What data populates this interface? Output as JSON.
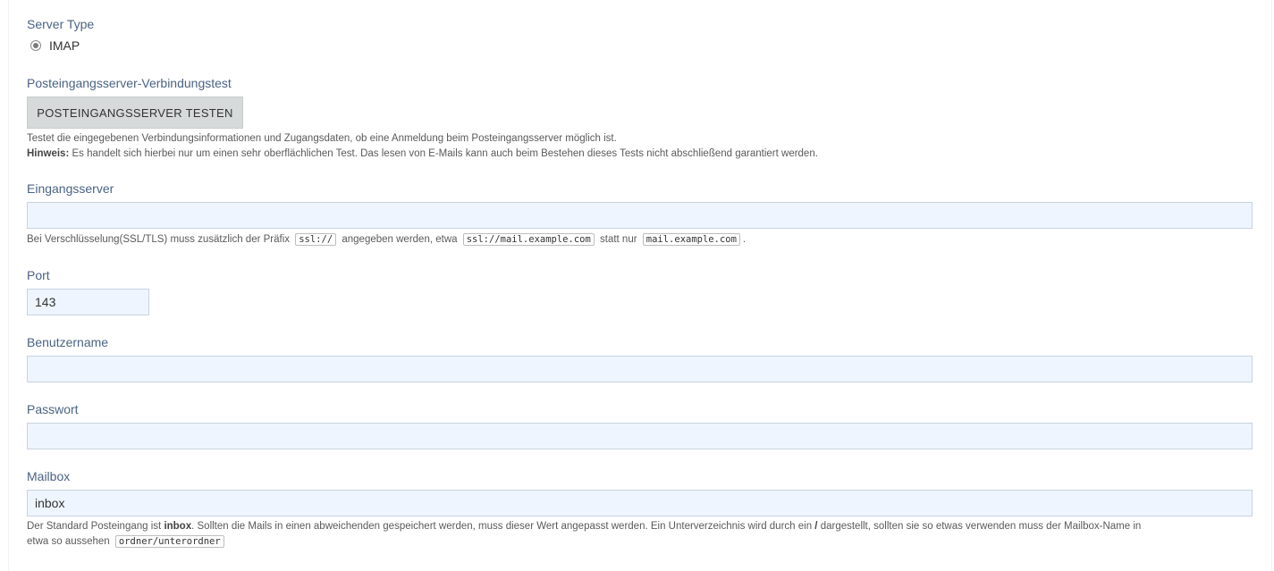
{
  "server_type": {
    "label": "Server Type",
    "option": "IMAP"
  },
  "connection_test": {
    "label": "Posteingangsserver-Verbindungstest",
    "button": "POSTEINGANGSSERVER TESTEN",
    "help_line1": "Testet die eingegebenen Verbindungsinformationen und Zugangsdaten, ob eine Anmeldung beim Posteingangsserver möglich ist.",
    "hint_label": "Hinweis:",
    "hint_text": " Es handelt sich hierbei nur um einen sehr oberflächlichen Test. Das lesen von E-Mails kann auch beim Bestehen dieses Tests nicht abschließend garantiert werden."
  },
  "incoming_server": {
    "label": "Eingangsserver",
    "value": "",
    "help_pre": "Bei Verschlüsselung(SSL/TLS) muss zusätzlich der Präfix",
    "code1": "ssl://",
    "help_mid": "angegeben werden, etwa",
    "code2": "ssl://mail.example.com",
    "help_mid2": "statt nur",
    "code3": "mail.example.com",
    "help_end": "."
  },
  "port": {
    "label": "Port",
    "value": "143"
  },
  "username": {
    "label": "Benutzername",
    "value": ""
  },
  "password": {
    "label": "Passwort",
    "value": ""
  },
  "mailbox": {
    "label": "Mailbox",
    "value": "inbox",
    "help_pre": "Der Standard Posteingang ist ",
    "help_bold1": "inbox",
    "help_mid": ". Sollten die Mails in einen abweichenden gespeichert werden, muss dieser Wert angepasst werden. Ein Unterverzeichnis wird durch ein ",
    "help_bold2": "/",
    "help_post": " dargestellt, sollten sie so etwas verwenden muss der Mailbox-Name in",
    "help_line2": "etwa so aussehen",
    "code": "ordner/unterordner"
  }
}
